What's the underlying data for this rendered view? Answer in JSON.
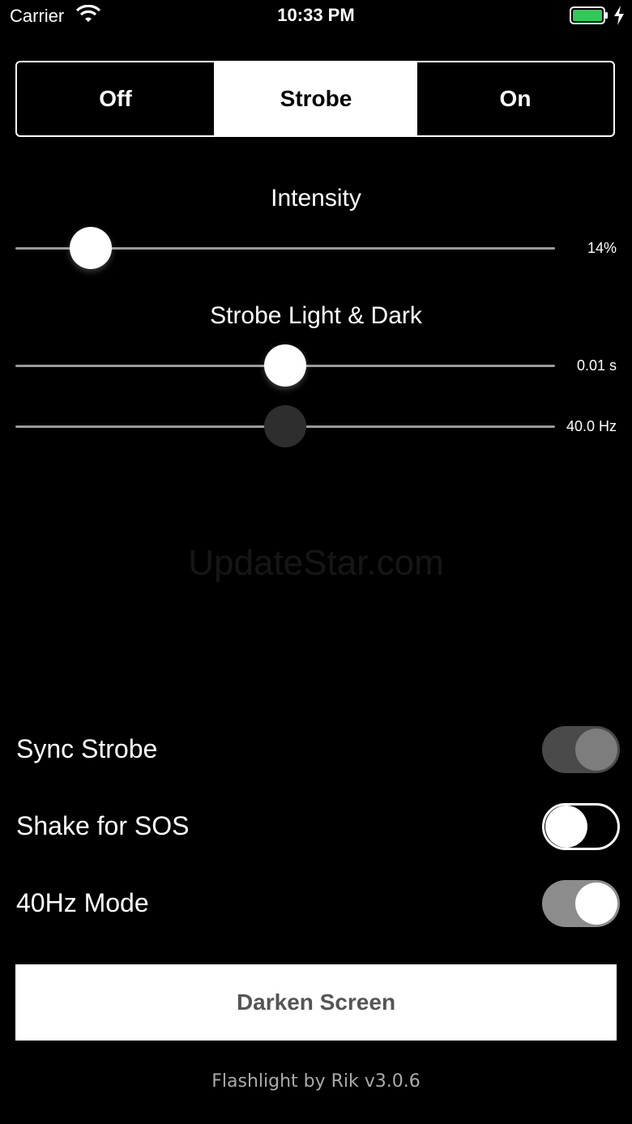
{
  "status_bar": {
    "carrier": "Carrier",
    "time": "10:33 PM",
    "battery_color": "#34c759"
  },
  "modes": {
    "items": [
      "Off",
      "Strobe",
      "On"
    ],
    "selected": "Strobe"
  },
  "intensity": {
    "label": "Intensity",
    "value_text": "14%",
    "level": 0.14
  },
  "strobe": {
    "label": "Strobe Light & Dark",
    "duration_text": "0.01 s",
    "duration_level": 0.5,
    "frequency_text": "40.0 Hz",
    "frequency_level": 0.5
  },
  "watermark": "UpdateStar.com",
  "toggles": {
    "sync_strobe": {
      "label": "Sync Strobe",
      "on": true,
      "enabled": false
    },
    "shake_sos": {
      "label": "Shake for SOS",
      "on": false,
      "enabled": true
    },
    "mode_40hz": {
      "label": "40Hz Mode",
      "on": true,
      "enabled": true
    }
  },
  "darken_button": "Darken Screen",
  "footer": "Flashlight by Rik v3.0.6"
}
